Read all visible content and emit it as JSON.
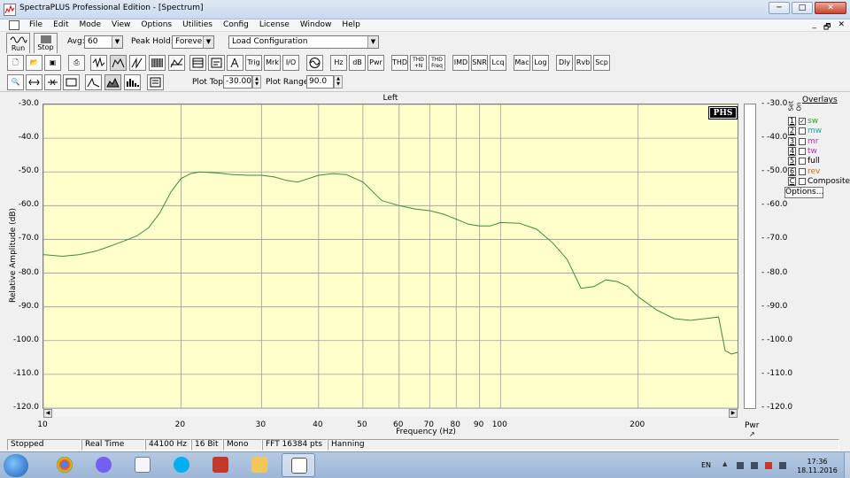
{
  "window": {
    "title": "SpectraPLUS Professional Edition - [Spectrum]",
    "minimize": "─",
    "maximize": "□",
    "close": "✕"
  },
  "menu": {
    "items": [
      "File",
      "Edit",
      "Mode",
      "View",
      "Options",
      "Utilities",
      "Config",
      "License",
      "Window",
      "Help"
    ],
    "mdi_min": "_",
    "mdi_restore": "🗗",
    "mdi_close": "✕"
  },
  "toolbar1": {
    "run_label": "Run",
    "stop_label": "Stop",
    "avg_label": "Avg:",
    "avg_value": "60",
    "peak_label": "Peak Hold:",
    "peak_value": "Forever",
    "config_value": "Load Configuration"
  },
  "toolbar2": {
    "text_buttons": [
      "Trig",
      "Mrk",
      "I/O",
      "Hz",
      "dB",
      "Pwr",
      "THD",
      "THD +N",
      "THD Freq",
      "IMD",
      "SNR",
      "Lcq",
      "Mac",
      "Log",
      "Dly",
      "Rvb",
      "Scp"
    ]
  },
  "toolbar3": {
    "plot_top_label": "Plot Top:",
    "plot_top_value": "-30.00",
    "plot_range_label": "Plot Range:",
    "plot_range_value": "90.0"
  },
  "graph": {
    "channel": "Left",
    "watermark": "PHS",
    "pwr_label": "Pwr",
    "ylabel": "Relative Amplitude (dB)",
    "xlabel": "Frequency (Hz)",
    "yticks": [
      "-30.0",
      "-40.0",
      "-50.0",
      "-60.0",
      "-70.0",
      "-80.0",
      "-90.0",
      "-100.0",
      "-110.0",
      "-120.0"
    ],
    "xticks": [
      "10",
      "20",
      "30",
      "40",
      "50",
      "60",
      "70",
      "80",
      "90",
      "100",
      "200"
    ],
    "trace_color": "#3c8a3c",
    "bg_color": "#ffffcc"
  },
  "chart_data": {
    "type": "line",
    "title": "Left",
    "xlabel": "Frequency (Hz)",
    "ylabel": "Relative Amplitude (dB)",
    "x_scale": "log",
    "xlim": [
      10,
      330
    ],
    "ylim": [
      -120,
      -30
    ],
    "grid": true,
    "series": [
      {
        "x": [
          10,
          11,
          12,
          13,
          14,
          15,
          16,
          17,
          18,
          19,
          20,
          21,
          22,
          24,
          26,
          28,
          30,
          32,
          34,
          36,
          38,
          40,
          43,
          46,
          50,
          55,
          60,
          65,
          70,
          75,
          80,
          85,
          90,
          95,
          100,
          110,
          120,
          130,
          140,
          150,
          160,
          170,
          180,
          190,
          200,
          220,
          240,
          260,
          280,
          300,
          310,
          320,
          330
        ],
        "y": [
          -74.5,
          -75,
          -74.5,
          -73.5,
          -72,
          -70.5,
          -69,
          -66.5,
          -62,
          -56,
          -52,
          -50.5,
          -50,
          -50.3,
          -50.8,
          -51,
          -51,
          -51.5,
          -52.5,
          -53,
          -52,
          -51,
          -50.5,
          -50.8,
          -53,
          -58.5,
          -60,
          -61,
          -61.5,
          -62.5,
          -64,
          -65.5,
          -66,
          -66,
          -65,
          -65.2,
          -67,
          -71,
          -76,
          -84.5,
          -84,
          -82,
          -82.5,
          -84,
          -87,
          -91,
          -93.5,
          -94,
          -93.5,
          -93,
          -103,
          -104,
          -103.5
        ]
      }
    ]
  },
  "overlays": {
    "title": "Overlays",
    "hdr_set": "Set",
    "hdr_on": "On",
    "rows": [
      {
        "num": "1",
        "checked": "✓",
        "name": "sw",
        "color": "#2e9f2e"
      },
      {
        "num": "2",
        "checked": "",
        "name": "mw",
        "color": "#16a9a9"
      },
      {
        "num": "3",
        "checked": "",
        "name": "mr",
        "color": "#b52fb5"
      },
      {
        "num": "4",
        "checked": "",
        "name": "tw",
        "color": "#b52fb5"
      },
      {
        "num": "5",
        "checked": "",
        "name": "full",
        "color": "#000000"
      },
      {
        "num": "6",
        "checked": "",
        "name": "rev",
        "color": "#d2691e"
      },
      {
        "num": "C",
        "checked": "",
        "name": "Composite",
        "color": "#000000"
      }
    ],
    "options_label": "Options..."
  },
  "status": [
    "Stopped",
    "Real Time",
    "44100 Hz",
    "16 Bit",
    "Mono",
    "FFT 16384 pts",
    "Hanning"
  ],
  "taskbar": {
    "lang": "EN",
    "time": "17:36",
    "date": "18.11.2016",
    "apps": [
      "chrome-icon",
      "viber-icon",
      "document-icon",
      "skype-icon",
      "toolbox-icon",
      "folder-icon",
      "spectraplus-icon"
    ]
  }
}
